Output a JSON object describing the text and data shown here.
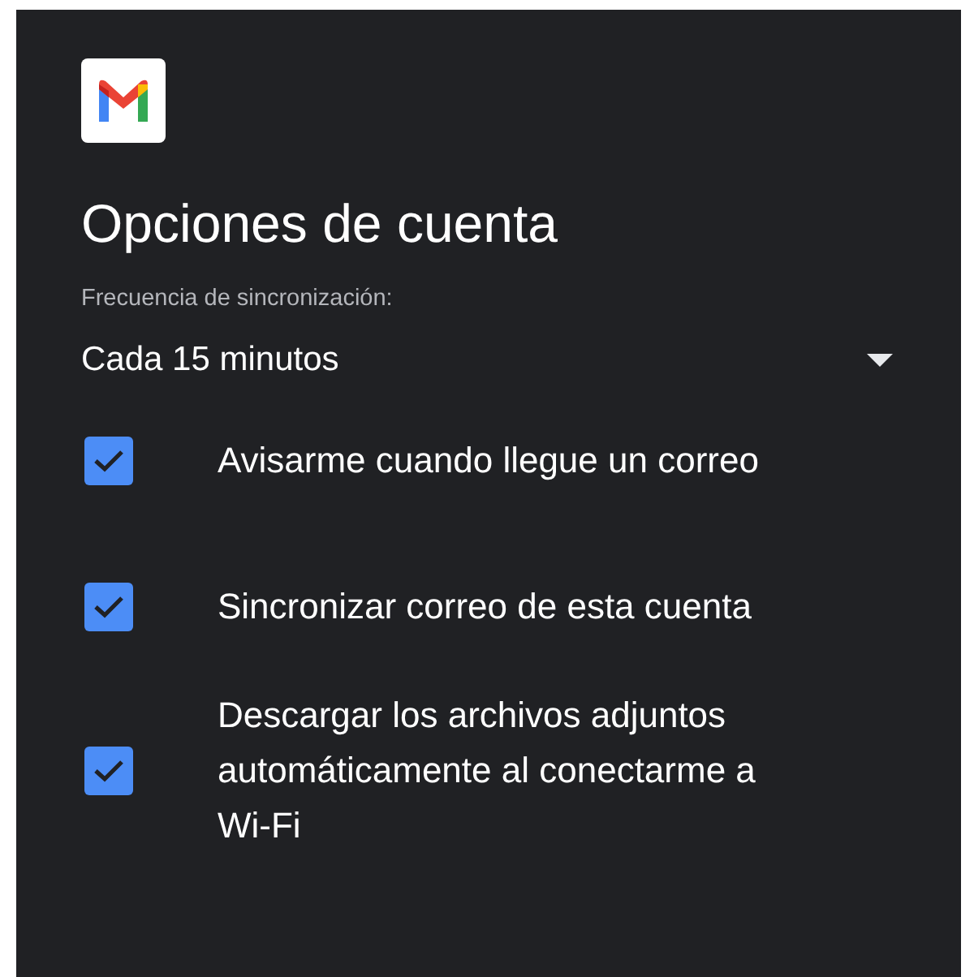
{
  "title": "Opciones de cuenta",
  "sync": {
    "label": "Frecuencia de sincronización:",
    "value": "Cada 15 minutos"
  },
  "options": [
    {
      "label": "Avisarme cuando llegue un correo",
      "checked": true
    },
    {
      "label": "Sincronizar correo de esta cuenta",
      "checked": true
    },
    {
      "label": "Descargar los archivos adjuntos automáticamente al conectarme a Wi-Fi",
      "checked": true
    }
  ]
}
